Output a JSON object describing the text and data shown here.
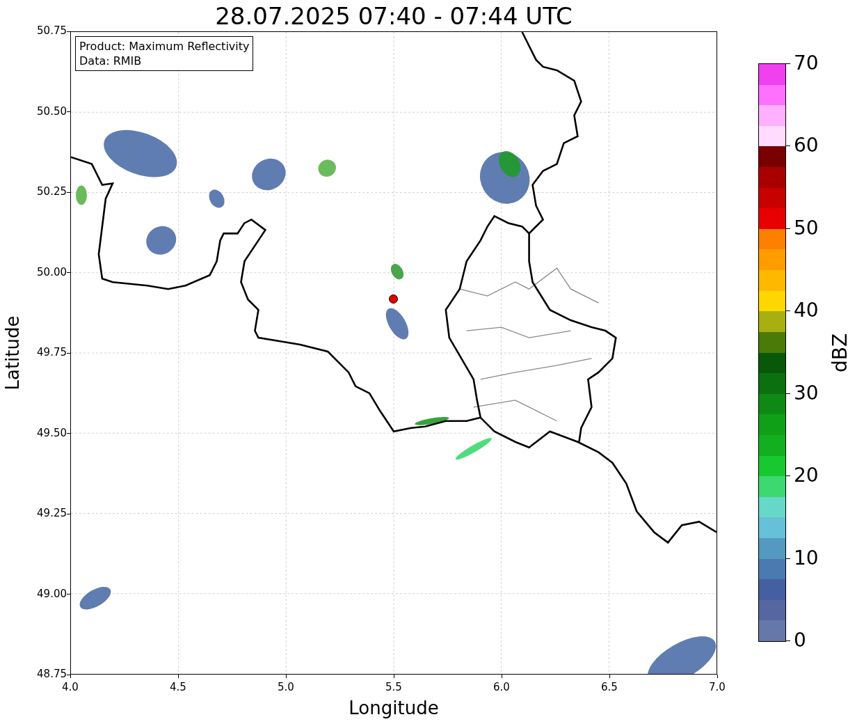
{
  "title": "28.07.2025 07:40 - 07:44 UTC",
  "legend": [
    "Product: Maximum Reflectivity",
    "Data: RMIB"
  ],
  "x_axis": {
    "label": "Longitude",
    "ticks": [
      "4.0",
      "4.5",
      "5.0",
      "5.5",
      "6.0",
      "6.5",
      "7.0"
    ]
  },
  "y_axis": {
    "label": "Latitude",
    "ticks": [
      "50.75",
      "50.50",
      "50.25",
      "50.00",
      "49.75",
      "49.50",
      "49.25",
      "49.00",
      "48.75"
    ]
  },
  "colorbar": {
    "label": "dBZ",
    "ticks": [
      "70",
      "60",
      "50",
      "40",
      "30",
      "20",
      "10",
      "0"
    ],
    "segments": [
      {
        "color": "#f040f0"
      },
      {
        "color": "#ff70ff"
      },
      {
        "color": "#ffb0ff"
      },
      {
        "color": "#ffdcff"
      },
      {
        "color": "#7a0000"
      },
      {
        "color": "#a80000"
      },
      {
        "color": "#c80000"
      },
      {
        "color": "#e80000"
      },
      {
        "color": "#ff7f00"
      },
      {
        "color": "#ff9c00"
      },
      {
        "color": "#ffb800"
      },
      {
        "color": "#ffd700"
      },
      {
        "color": "#a8b010"
      },
      {
        "color": "#4a7a08"
      },
      {
        "color": "#085808"
      },
      {
        "color": "#0b7010"
      },
      {
        "color": "#0e8a14"
      },
      {
        "color": "#10a018"
      },
      {
        "color": "#12b020"
      },
      {
        "color": "#18c830"
      },
      {
        "color": "#3dd870"
      },
      {
        "color": "#66d8c8"
      },
      {
        "color": "#66c0d8"
      },
      {
        "color": "#5599c0"
      },
      {
        "color": "#4a7ab0"
      },
      {
        "color": "#4560a0"
      },
      {
        "color": "#5566a0"
      },
      {
        "color": "#6677aa"
      }
    ]
  }
}
